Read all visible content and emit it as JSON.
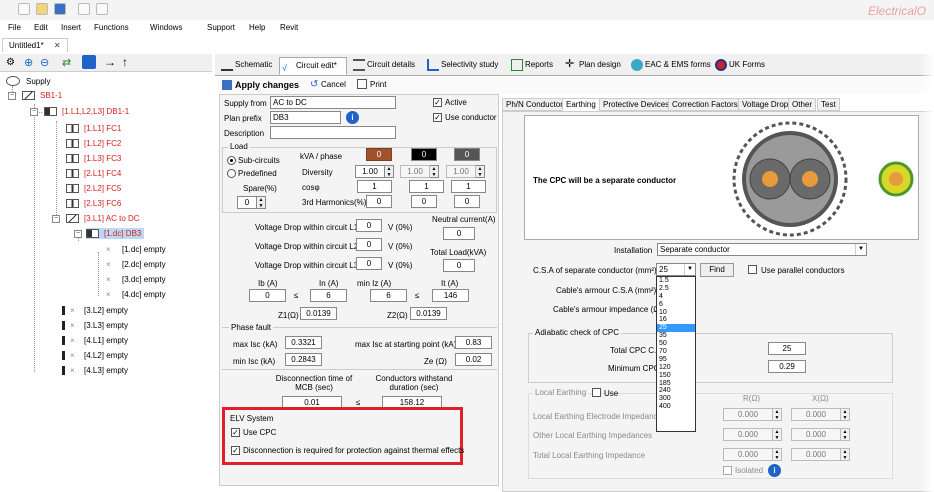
{
  "brand": "ElectricalO",
  "menu": [
    "File",
    "Edit",
    "Insert",
    "Functions",
    "Windows",
    "Support",
    "Help",
    "Revit"
  ],
  "doc_tab": "Untitled1*",
  "doc_tab_close": "✕",
  "tree": {
    "supply": "Supply",
    "sb": "SB1-1",
    "db": "[1.L1,L2,L3] DB1-1",
    "fc": [
      "[1.L1] FC1",
      "[1.L2] FC2",
      "[1.L3] FC3",
      "[2.L1] FC4",
      "[2.L2] FC5",
      "[2.L3] FC6"
    ],
    "ac": "[3.L1] AC to DC",
    "dc": "[1.dc] DB3",
    "dc_children": [
      "[1.dc] empty",
      "[2.dc] empty",
      "[3.dc] empty",
      "[4.dc] empty"
    ],
    "empties": [
      "[3.L2] empty",
      "[3.L3] empty",
      "[4.L1] empty",
      "[4.L2] empty",
      "[4.L3] empty"
    ]
  },
  "main_tabs": [
    "Schematic",
    "Circuit edit*",
    "Circuit details",
    "Selectivity study",
    "Reports",
    "Plan design",
    "EAC & EMS forms",
    "UK Forms"
  ],
  "actions": {
    "apply": "Apply changes",
    "cancel": "Cancel",
    "print": "Print"
  },
  "form": {
    "supply_from_label": "Supply from",
    "supply_from": "AC to DC",
    "plan_prefix_label": "Plan prefix",
    "plan_prefix": "DB3",
    "description_label": "Description",
    "active": "Active",
    "use_conductor": "Use conductor",
    "load_label": "Load",
    "sub_circuits": "Sub-circuits",
    "predefined": "Predefined",
    "kva_label": "kVA / phase",
    "kva": [
      "0",
      "0",
      "0"
    ],
    "diversity_label": "Diversity",
    "diversity": [
      "1.00",
      "1.00",
      "1.00"
    ],
    "cosphi_label": "cosφ",
    "cosphi": [
      "1",
      "1",
      "1"
    ],
    "harm_label": "3rd Harmonics(%)",
    "harm": [
      "0",
      "0",
      "0"
    ],
    "spare_label": "Spare(%)",
    "spare": "0",
    "vd1_label": "Voltage Drop within circuit L1",
    "vd1": "0",
    "vd2_label": "Voltage Drop within circuit L2",
    "vd2": "0",
    "vd3_label": "Voltage Drop within circuit L3",
    "vd3": "0",
    "vunit": "V (0%)",
    "neutral_label": "Neutral current(A)",
    "neutral": "0",
    "total_load_label": "Total Load(kVA)",
    "total_load": "0",
    "ib_label": "Ib (A)",
    "ib": "0",
    "in_label": "In (A)",
    "in": "6",
    "miniz_label": "min Iz (A)",
    "miniz": "6",
    "it_label": "It (A)",
    "it": "146",
    "leq": "≤",
    "z1_label": "Z1(Ω)",
    "z1": "0.0139",
    "z2_label": "Z2(Ω)",
    "z2": "0.0139",
    "phase_fault": "Phase fault",
    "maxisc_label": "max Isc (kA)",
    "maxisc": "0.3321",
    "maxisc_start_label": "max Isc at starting point (kA)",
    "maxisc_start": "0.83",
    "minisc_label": "min Isc (kA)",
    "minisc": "0.2843",
    "ze_label": "Ze (Ω)",
    "ze": "0.02",
    "disc_label": "Disconnection time of MCB (sec)",
    "disc": "0.01",
    "cond_label": "Conductors withstand duration (sec)",
    "cond": "158.12",
    "elv": "ELV System",
    "use_cpc": "Use CPC",
    "disc_req": "Disconnection is required for protection against thermal effects"
  },
  "right_tabs": [
    "Ph/N Conductor",
    "Earthing",
    "Protective Devices",
    "Correction Factors",
    "Voltage Drop",
    "Other",
    "Test"
  ],
  "earthing": {
    "cpc_msg": "The CPC will be a separate conductor",
    "installation_label": "Installation",
    "installation": "Separate conductor",
    "csa_label": "C.S.A of separate conductor (mm²)",
    "csa": "25",
    "find": "Find",
    "parallel": "Use parallel conductors",
    "armour_csa_label": "Cable's armour C.S.A (mm²)",
    "armour_imp_label": "Cable's armour impedance (Ω)",
    "adiabatic": "Adiabatic check of CPC",
    "total_cpc_label": "Total CPC C.S.",
    "total_cpc": "25",
    "min_cpc_label": "Minimum CPC C",
    "min_cpc": "0.29",
    "local_earthing": "Local Earthing",
    "use": "Use",
    "r_label": "R(Ω)",
    "x_label": "X(Ω)",
    "le1_label": "Local Earthing Electrode Impedance",
    "le2_label": "Other Local Earthing Impedances",
    "le3_label": "Total Local Earthing Impedance",
    "le_vals": [
      "0.000",
      "0.000",
      "0.000",
      "0.000",
      "0.000",
      "0.000"
    ],
    "isolated": "Isolated",
    "dropdown": [
      "1.5",
      "2.5",
      "4",
      "6",
      "10",
      "16",
      "25",
      "35",
      "50",
      "70",
      "95",
      "120",
      "150",
      "185",
      "240",
      "300",
      "400"
    ],
    "dropdown_selected": "25"
  },
  "colors": {
    "kva1": "#a0522d",
    "kva2": "#000000",
    "kva3": "#555555",
    "red": "#e0202a",
    "accent": "#1f63c9"
  }
}
